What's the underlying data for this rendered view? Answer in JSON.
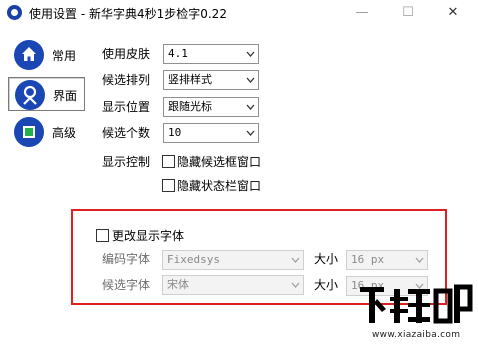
{
  "window": {
    "title": "使用设置 - 新华字典4秒1步检字0.22",
    "minimize_glyph": "—",
    "maximize_glyph": "☐",
    "close_glyph": "✕"
  },
  "nav": {
    "items": [
      {
        "label": "常用",
        "icon": "home-icon",
        "selected": false
      },
      {
        "label": "界面",
        "icon": "appearance-icon",
        "selected": true
      },
      {
        "label": "高级",
        "icon": "advanced-icon",
        "selected": false
      }
    ]
  },
  "settings": {
    "skin": {
      "label": "使用皮肤",
      "value": "4.1"
    },
    "candidate_layout": {
      "label": "候选排列",
      "value": "竖排样式"
    },
    "display_position": {
      "label": "显示位置",
      "value": "跟随光标"
    },
    "candidate_count": {
      "label": "候选个数",
      "value": "10"
    },
    "display_control": {
      "label": "显示控制",
      "hide_candidate_window": {
        "label": "隐藏候选框窗口",
        "checked": false
      },
      "hide_status_window": {
        "label": "隐藏状态栏窗口",
        "checked": false
      }
    }
  },
  "font_settings": {
    "change_font": {
      "label": "更改显示字体",
      "checked": false
    },
    "encoding_font": {
      "label": "编码字体",
      "value": "Fixedsys",
      "size_label": "大小",
      "size_value": "16 px"
    },
    "candidate_font": {
      "label": "候选字体",
      "value": "宋体",
      "size_label": "大小",
      "size_value": "16 px"
    }
  },
  "watermark": {
    "logo_text": "下载吧",
    "url_text": "www.xiazaiba.com"
  },
  "colors": {
    "nav_icon_blue": "#1a47b4",
    "highlight_frame": "#e02020",
    "advanced_icon_green": "#22b14c"
  }
}
